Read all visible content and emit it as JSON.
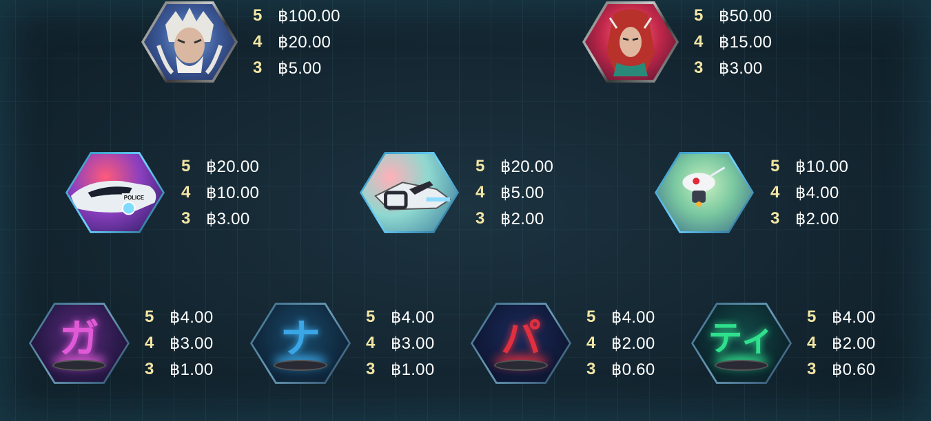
{
  "currency_symbol": "฿",
  "symbols": [
    {
      "id": "elder",
      "icon": "elder-warrior-icon",
      "pays": [
        {
          "count": "5",
          "amount": "฿100.00"
        },
        {
          "count": "4",
          "amount": "฿20.00"
        },
        {
          "count": "3",
          "amount": "฿5.00"
        }
      ]
    },
    {
      "id": "redhair",
      "icon": "red-haired-warrior-icon",
      "pays": [
        {
          "count": "5",
          "amount": "฿50.00"
        },
        {
          "count": "4",
          "amount": "฿15.00"
        },
        {
          "count": "3",
          "amount": "฿3.00"
        }
      ]
    },
    {
      "id": "police",
      "icon": "police-hovercar-icon",
      "police_label": "POLICE",
      "pays": [
        {
          "count": "5",
          "amount": "฿20.00"
        },
        {
          "count": "4",
          "amount": "฿10.00"
        },
        {
          "count": "3",
          "amount": "฿3.00"
        }
      ]
    },
    {
      "id": "bike",
      "icon": "hoverbike-icon",
      "pays": [
        {
          "count": "5",
          "amount": "฿20.00"
        },
        {
          "count": "4",
          "amount": "฿5.00"
        },
        {
          "count": "3",
          "amount": "฿2.00"
        }
      ]
    },
    {
      "id": "drone",
      "icon": "drone-icon",
      "pays": [
        {
          "count": "5",
          "amount": "฿10.00"
        },
        {
          "count": "4",
          "amount": "฿4.00"
        },
        {
          "count": "3",
          "amount": "฿2.00"
        }
      ]
    },
    {
      "id": "ga",
      "icon": "katakana-ga-icon",
      "glyph": "ガ",
      "color": "#e05ad8",
      "pays": [
        {
          "count": "5",
          "amount": "฿4.00"
        },
        {
          "count": "4",
          "amount": "฿3.00"
        },
        {
          "count": "3",
          "amount": "฿1.00"
        }
      ]
    },
    {
      "id": "na",
      "icon": "katakana-na-icon",
      "glyph": "ナ",
      "color": "#3aa6e6",
      "pays": [
        {
          "count": "5",
          "amount": "฿4.00"
        },
        {
          "count": "4",
          "amount": "฿3.00"
        },
        {
          "count": "3",
          "amount": "฿1.00"
        }
      ]
    },
    {
      "id": "pa",
      "icon": "katakana-pa-icon",
      "glyph": "パ",
      "color": "#e0303f",
      "pays": [
        {
          "count": "5",
          "amount": "฿4.00"
        },
        {
          "count": "4",
          "amount": "฿2.00"
        },
        {
          "count": "3",
          "amount": "฿0.60"
        }
      ]
    },
    {
      "id": "ti",
      "icon": "katakana-ti-icon",
      "glyph": "ティ",
      "color": "#2fe08d",
      "pays": [
        {
          "count": "5",
          "amount": "฿4.00"
        },
        {
          "count": "4",
          "amount": "฿2.00"
        },
        {
          "count": "3",
          "amount": "฿0.60"
        }
      ]
    }
  ]
}
